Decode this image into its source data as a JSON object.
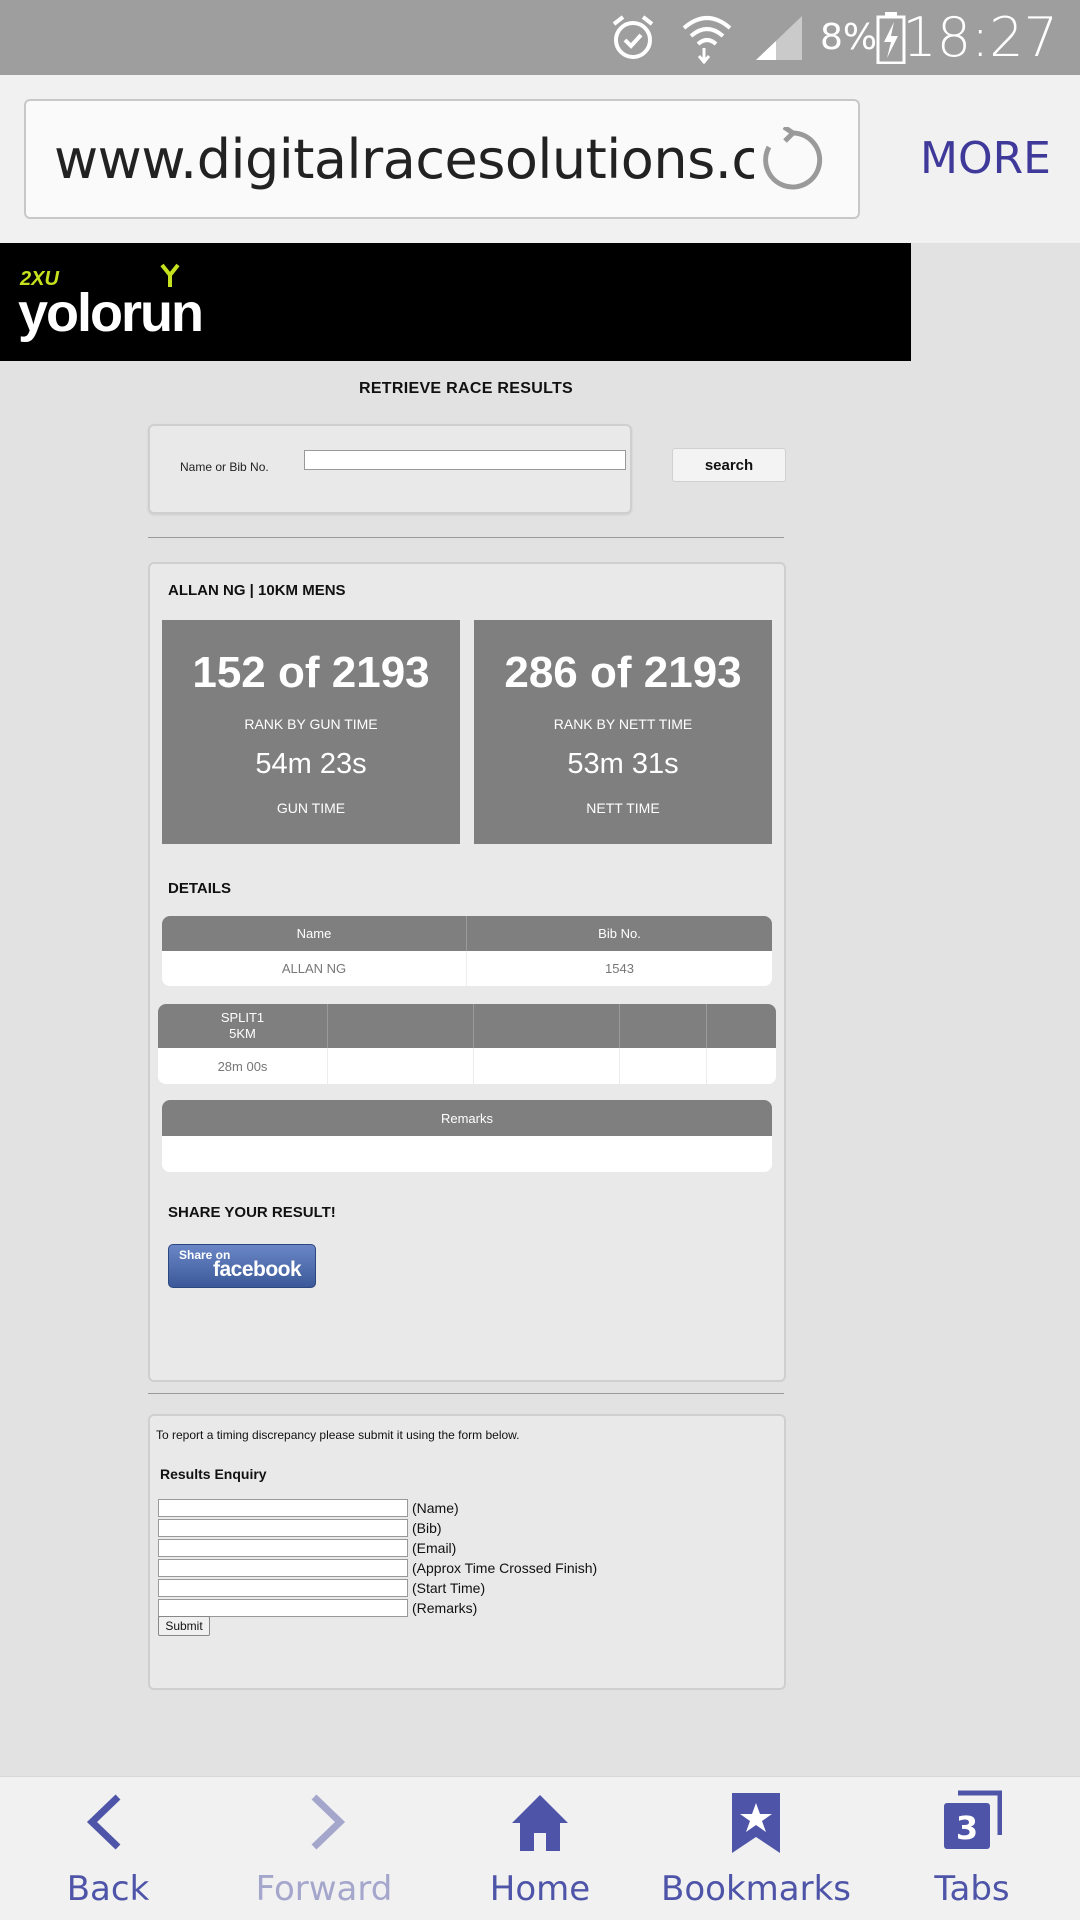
{
  "status_bar": {
    "time": "18:27",
    "battery_percent": "8%",
    "icons": [
      "alarm-icon",
      "wifi-icon",
      "signal-icon",
      "battery-charging-icon"
    ]
  },
  "browser": {
    "url": "www.digitalracesolutions.c",
    "more_label": "MORE"
  },
  "page": {
    "title": "RETRIEVE RACE RESULTS",
    "search": {
      "label": "Name or Bib No.",
      "value": "",
      "button": "search"
    },
    "result": {
      "athlete": "ALLAN NG | 10KM MENS",
      "gun": {
        "rank": "152 of 2193",
        "rank_label": "RANK BY GUN TIME",
        "time": "54m 23s",
        "time_label": "GUN TIME"
      },
      "nett": {
        "rank": "286 of 2193",
        "rank_label": "RANK BY NETT TIME",
        "time": "53m 31s",
        "time_label": "NETT TIME"
      },
      "details_title": "DETAILS",
      "details_table": {
        "headers": [
          "Name",
          "Bib No."
        ],
        "row": [
          "ALLAN NG",
          "1543"
        ]
      },
      "splits_table": {
        "header_line1": "SPLIT1",
        "header_line2": "5KM",
        "value": "28m 00s"
      },
      "remarks_title": "Remarks",
      "remarks_value": "",
      "share_title": "SHARE YOUR RESULT!",
      "share_button_top": "Share on",
      "share_button_main": "facebook"
    },
    "enquiry": {
      "note": "To report a timing discrepancy please submit it using the form below.",
      "title": "Results Enquiry",
      "fields": [
        "(Name)",
        "(Bib)",
        "(Email)",
        "(Approx Time Crossed Finish)",
        "(Start Time)",
        "(Remarks)"
      ],
      "submit": "Submit"
    }
  },
  "toolbar": {
    "back": "Back",
    "forward": "Forward",
    "home": "Home",
    "bookmarks": "Bookmarks",
    "tabs": "Tabs",
    "tab_count": "3"
  },
  "colors": {
    "accent": "#4e55a8",
    "rank_box": "#7f7f7f",
    "brand_bar": "#000000",
    "logo_accent": "#c6e11d"
  }
}
